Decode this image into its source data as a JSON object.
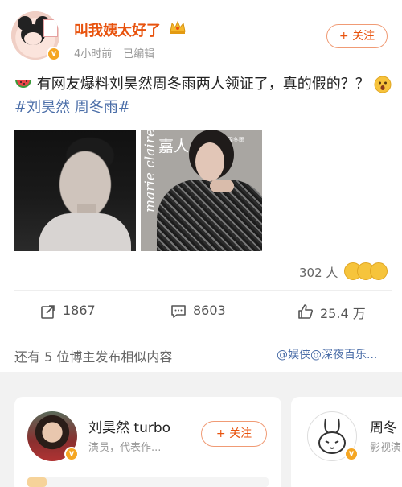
{
  "post": {
    "username": "叫我姨太好了",
    "time": "4小时前",
    "edited": "已编辑",
    "follow_label": "+ 关注",
    "content_text": "有网友爆料刘昊然周冬雨两人领证了，真的假的？？",
    "hashtags": "#刘昊然 周冬雨#",
    "likes_count": "302 人",
    "actions": {
      "repost": "1867",
      "comments": "8603",
      "likes": "25.4 万"
    }
  },
  "image2": {
    "magazine": "marie claire",
    "chinese": "嘉人",
    "small": "周冬雨"
  },
  "similar": {
    "text": "还有 5 位博主发布相似内容",
    "tags": "@娱侠@深夜百乐..."
  },
  "cards": [
    {
      "name": "刘昊然 turbo",
      "desc": "演员，代表作...",
      "button": "+ 关注"
    },
    {
      "name": "周冬",
      "desc": "影视演"
    }
  ],
  "colors": {
    "accent": "#e8530e",
    "link": "#4b6ea8",
    "vip_badge": "#f5a623"
  },
  "icons": [
    "watermelon-icon",
    "shocked-face-icon",
    "crown-icon",
    "repost-icon",
    "comment-icon",
    "like-icon",
    "verified-icon"
  ]
}
